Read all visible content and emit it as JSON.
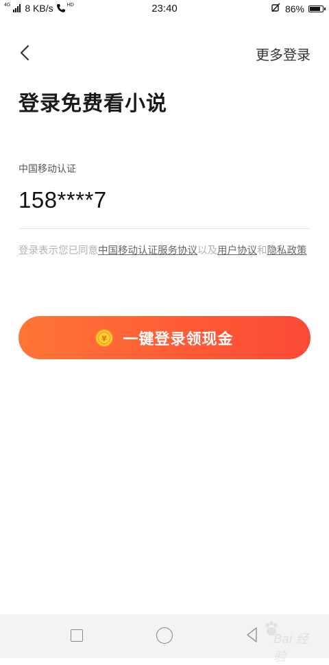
{
  "status_bar": {
    "network_type": "4G",
    "speed": "8 KB/s",
    "call_tag": "HD",
    "time": "23:40",
    "battery": "86%",
    "battery_level": 0.86
  },
  "header": {
    "back_icon": "chevron-left-icon",
    "more_login": "更多登录"
  },
  "title": "登录免费看小说",
  "auth": {
    "provider_label": "中国移动认证",
    "phone_number": "158****7"
  },
  "agreement": {
    "prefix": "登录表示您已同意",
    "link1": "中国移动认证服务协议",
    "mid": "以及",
    "link2": "用户协议",
    "and": "和",
    "link3": "隐私政策"
  },
  "login_button": {
    "label": "一键登录领现金",
    "icon": "coin-icon",
    "coin_symbol": "¥",
    "colors": {
      "start": "#ff7636",
      "end": "#fa4a36",
      "coin": "#ffcc33"
    }
  },
  "nav_bar": {
    "recent_icon": "square-icon",
    "home_icon": "circle-icon",
    "back_icon": "triangle-back-icon",
    "watermark": "Bai 经验"
  }
}
